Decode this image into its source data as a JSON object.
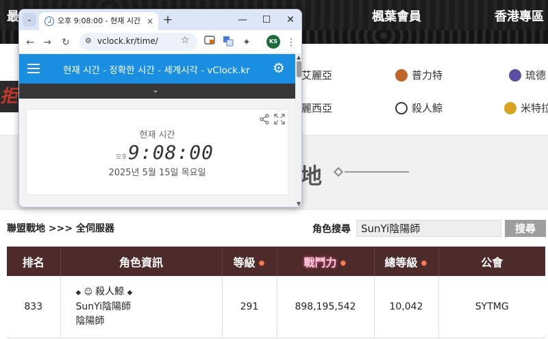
{
  "site": {
    "nav": {
      "item1": "最",
      "item2": "楓葉會員",
      "item3": "香港專區"
    },
    "jobs": {
      "col1_row1": "艾麗亞",
      "col1_row2": "麗西亞",
      "col2_row1": "普力特",
      "col2_row2": "殺人鯨",
      "col3_row1": "琉德",
      "col3_row2": "米特拉"
    },
    "banner_left_text": "拒",
    "hero_title": "地",
    "breadcrumb": "聯盟戰地 >>> 全伺服器",
    "search": {
      "label": "角色搜尋",
      "value": "SunYi陰陽師",
      "button": "搜尋"
    },
    "table": {
      "headers": {
        "rank": "排名",
        "info": "角色資訊",
        "level": "等級",
        "power": "戰鬥力",
        "total_level": "總等級",
        "guild": "公會"
      },
      "rows": [
        {
          "rank": "833",
          "world_icon": "殺人鯨",
          "name": "SunYi陰陽師",
          "job": "陰陽師",
          "level": "291",
          "power": "898,195,542",
          "total_level": "10,042",
          "guild": "SYTMG"
        }
      ]
    }
  },
  "browser": {
    "tab": {
      "title": "오후 9:08:00 - 현재 시간",
      "close": "×"
    },
    "new_tab": "+",
    "controls": {
      "minimize": "—",
      "maximize": "☐",
      "close": "✕"
    },
    "url": "vclock.kr/time/",
    "profile_initials": "KS",
    "vclock": {
      "header_title": "현재 시간 - 정확한 시간 - 세계시각 - vClock.kr",
      "card_label": "현재 시간",
      "ampm": "오후",
      "time": "9:08:00",
      "date": "2025년 5월 15일 목요일"
    }
  }
}
